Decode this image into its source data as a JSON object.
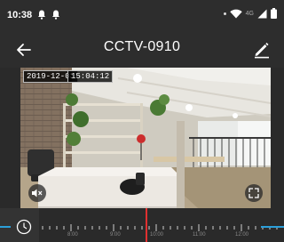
{
  "status_bar": {
    "time": "10:38",
    "network_label": "4G",
    "notification_icons": [
      "bell-icon",
      "bell-icon"
    ],
    "system_icons": [
      "dot-icon",
      "wifi-icon",
      "signal-icon",
      "battery-icon"
    ]
  },
  "app_bar": {
    "title": "CCTV-0910",
    "back_icon": "arrow-left-icon",
    "edit_icon": "pencil-icon"
  },
  "video": {
    "date": "2019-12-03",
    "time": "15:04:12",
    "mute_icon": "speaker-mute-icon",
    "fullscreen_icon": "fullscreen-icon"
  },
  "timeline": {
    "labels": [
      "8:00",
      "9:00",
      "10:00",
      "11:00",
      "12:00"
    ],
    "playhead_label": "",
    "colors": {
      "playhead": "#e03030",
      "accent": "#2b9fd9"
    }
  }
}
